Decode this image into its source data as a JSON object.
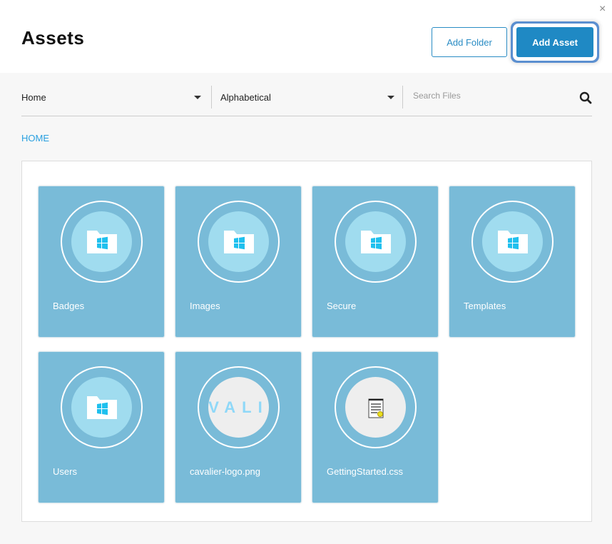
{
  "header": {
    "title": "Assets",
    "add_folder": "Add Folder",
    "add_asset": "Add Asset",
    "close": "×"
  },
  "filters": {
    "folder": "Home",
    "sort": "Alphabetical",
    "search_placeholder": "Search Files"
  },
  "breadcrumb": "HOME",
  "items": [
    {
      "label": "Badges",
      "type": "folder"
    },
    {
      "label": "Images",
      "type": "folder"
    },
    {
      "label": "Secure",
      "type": "folder"
    },
    {
      "label": "Templates",
      "type": "folder"
    },
    {
      "label": "Users",
      "type": "folder"
    },
    {
      "label": "cavalier-logo.png",
      "type": "image",
      "preview_text": "VALI"
    },
    {
      "label": "GettingStarted.css",
      "type": "file"
    }
  ]
}
